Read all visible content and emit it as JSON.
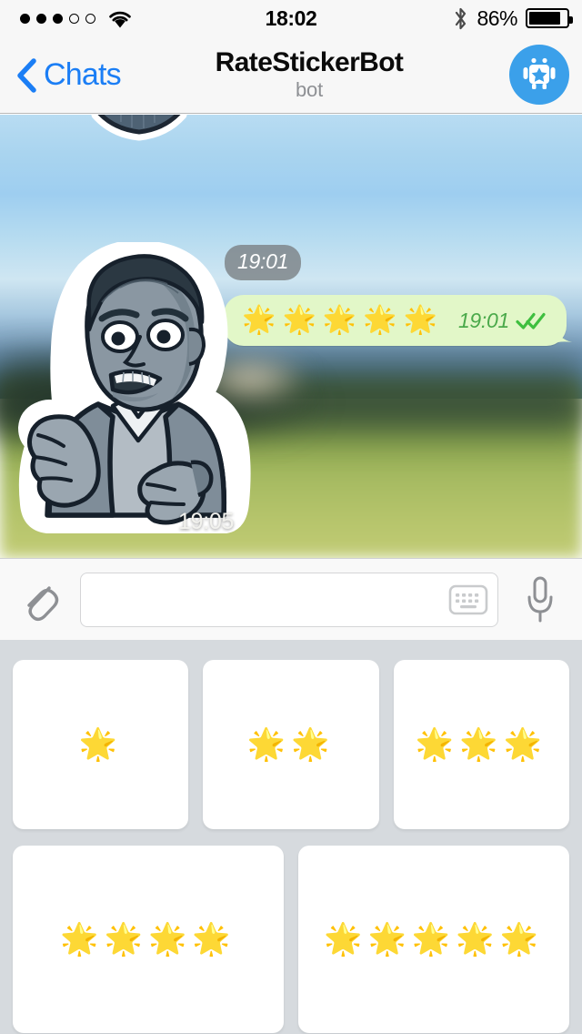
{
  "status_bar": {
    "signal_dots_filled": 3,
    "signal_dots_total": 5,
    "wifi_icon": "wifi-icon",
    "time": "18:02",
    "bluetooth_icon": "bluetooth-icon",
    "battery_percent": "86%",
    "battery_level": 86
  },
  "nav": {
    "back_label": "Chats",
    "back_icon": "chevron-left-icon",
    "title": "RateStickerBot",
    "subtitle": "bot",
    "avatar_icon": "robot-star-avatar-icon",
    "avatar_color": "#3ba0ea"
  },
  "chat": {
    "background": "blurred-landscape-photo",
    "messages": [
      {
        "type": "sticker-incoming-partial",
        "sticker_name": "dark-suit-sticker-bottom",
        "timestamp": "19:01",
        "timestamp_style": "pill"
      },
      {
        "type": "text-outgoing",
        "content": "🌟🌟🌟🌟🌟",
        "star_count": 5,
        "timestamp": "19:01",
        "status_icon": "double-check-icon",
        "bubble_color": "#e2f7c8",
        "timestamp_color": "#4aa94a"
      },
      {
        "type": "sticker-incoming",
        "sticker_name": "shocked-man-grayscale-sticker",
        "timestamp": "19:05"
      }
    ]
  },
  "input_bar": {
    "attach_icon": "paperclip-icon",
    "placeholder": "",
    "value": "",
    "keyboard_icon": "keyboard-icon",
    "mic_icon": "microphone-icon"
  },
  "suggestions": {
    "rows": [
      {
        "cards": [
          {
            "stars": "🌟",
            "star_count": 1
          },
          {
            "stars": "🌟🌟",
            "star_count": 2
          },
          {
            "stars": "🌟🌟🌟",
            "star_count": 3
          }
        ]
      },
      {
        "cards": [
          {
            "stars": "🌟🌟🌟🌟",
            "star_count": 4
          },
          {
            "stars": "🌟🌟🌟🌟🌟",
            "star_count": 5
          }
        ]
      }
    ],
    "background_color": "#d6dade",
    "card_color": "#ffffff"
  }
}
